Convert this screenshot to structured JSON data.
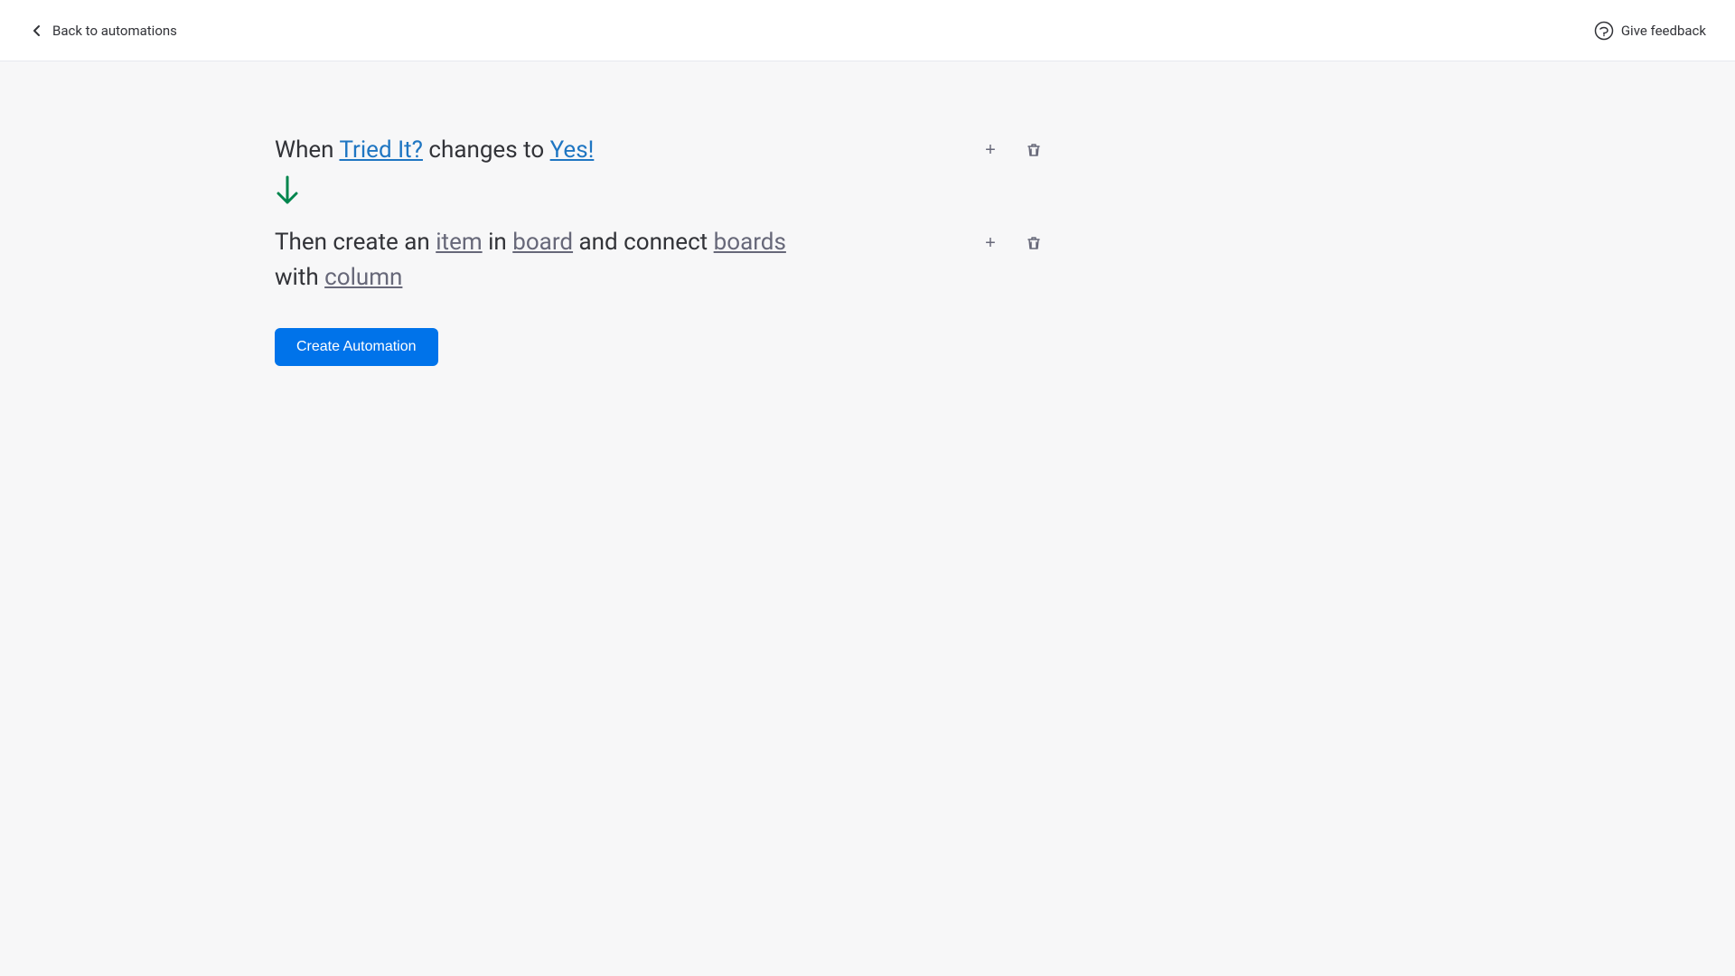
{
  "header": {
    "back_label": "Back to automations",
    "feedback_label": "Give feedback"
  },
  "trigger": {
    "prefix": "When ",
    "field": "Tried It?",
    "middle": " changes to ",
    "value": "Yes!"
  },
  "action": {
    "prefix": "Then create an ",
    "item_token": "item",
    "in_text": " in ",
    "board_token": "board",
    "and_text": " and connect ",
    "boards_token": "boards",
    "with_text": " with ",
    "column_token": "column"
  },
  "buttons": {
    "add_label": "+",
    "delete_label": "🗑",
    "create_automation_label": "Create Automation"
  },
  "icons": {
    "back_arrow": "←",
    "arrow_down": "↓",
    "feedback_bubble": "💬",
    "plus": "+",
    "trash": "🗑"
  }
}
